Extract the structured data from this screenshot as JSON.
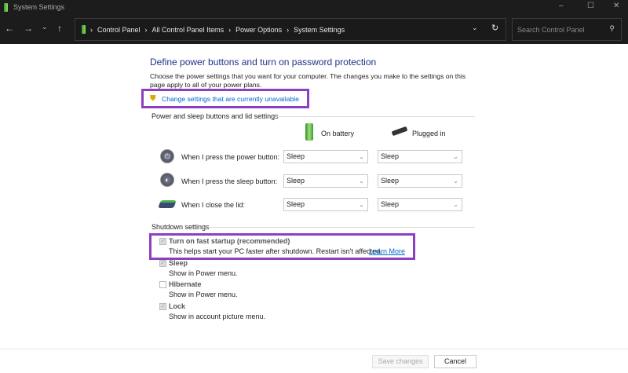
{
  "window": {
    "title": "System Settings"
  },
  "nav": {
    "breadcrumb": [
      "Control Panel",
      "All Control Panel Items",
      "Power Options",
      "System Settings"
    ],
    "search_placeholder": "Search Control Panel"
  },
  "main": {
    "heading": "Define power buttons and turn on password protection",
    "description": "Choose the power settings that you want for your computer. The changes you make to the settings on this page apply to all of your power plans.",
    "change_link": "Change settings that are currently unavailable",
    "power_section": "Power and sleep buttons and lid settings",
    "col_battery": "On battery",
    "col_plugged": "Plugged in",
    "rows": [
      {
        "label": "When I press the power button:",
        "battery": "Sleep",
        "plugged": "Sleep"
      },
      {
        "label": "When I press the sleep button:",
        "battery": "Sleep",
        "plugged": "Sleep"
      },
      {
        "label": "When I close the lid:",
        "battery": "Sleep",
        "plugged": "Sleep"
      }
    ],
    "shutdown_section": "Shutdown settings",
    "shutdown": [
      {
        "label": "Turn on fast startup (recommended)",
        "desc": "This helps start your PC faster after shutdown. Restart isn't affected.",
        "checked": true
      },
      {
        "label": "Sleep",
        "desc": "Show in Power menu.",
        "checked": true
      },
      {
        "label": "Hibernate",
        "desc": "Show in Power menu.",
        "checked": false
      },
      {
        "label": "Lock",
        "desc": "Show in account picture menu.",
        "checked": true
      }
    ],
    "learn_more": "Learn More"
  },
  "footer": {
    "save": "Save changes",
    "cancel": "Cancel"
  },
  "colors": {
    "highlight": "#8e3fc0",
    "heading": "#1e3287",
    "link": "#0066cc"
  }
}
